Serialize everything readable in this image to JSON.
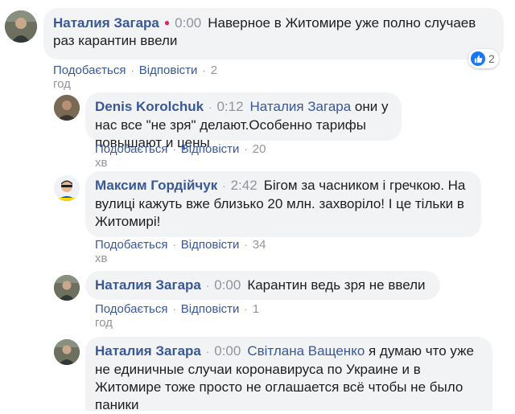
{
  "comments": [
    {
      "author": "Наталия Загара",
      "time": "0:00",
      "text": "Наверное в Житомире уже полно случаев раз карантин ввели",
      "like_label": "Подобається",
      "reply_label": "Відповісти",
      "age": "2 год",
      "reaction_count": "2"
    },
    {
      "author": "Denis Korolchuk",
      "time": "0:12",
      "mention": "Наталия Загара",
      "text": " они у нас все \"не зря\" делают.Особенно тарифы повышают и цены",
      "like_label": "Подобається",
      "reply_label": "Відповісти",
      "age": "20 хв"
    },
    {
      "author": "Максим Гордійчук",
      "time": "2:42",
      "text": "Бігом за часником і гречкою. На вулиці кажуть вже близько 20 млн. захворіло! І це тільки в Житомирі!",
      "like_label": "Подобається",
      "reply_label": "Відповісти",
      "age": "34 хв"
    },
    {
      "author": "Наталия Загара",
      "time": "0:00",
      "text": "Карантин ведь зря не ввели",
      "like_label": "Подобається",
      "reply_label": "Відповісти",
      "age": "1 год"
    },
    {
      "author": "Наталия Загара",
      "time": "0:00",
      "mention": "Світлана Ващенко",
      "text": " я думаю что уже не единичные случаи коронавируса по Украине и в Житомире тоже просто не оглашается всё чтобы не было паники"
    }
  ],
  "colors": {
    "link": "#385898",
    "bubble": "#f2f3f5",
    "meta": "#90949c",
    "like_blue": "#1877f2"
  }
}
